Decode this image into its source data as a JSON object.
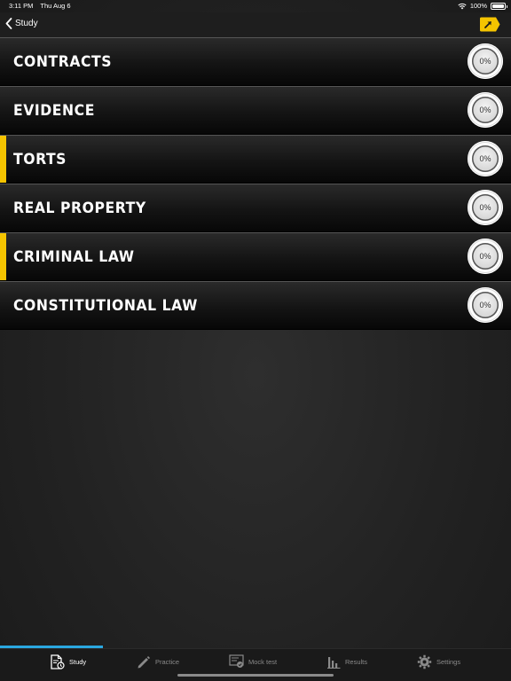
{
  "status_bar": {
    "time": "3:11 PM",
    "date": "Thu Aug 6",
    "battery": "100%",
    "wifi_icon": "wifi-icon",
    "battery_icon": "battery-icon"
  },
  "nav": {
    "back_label": "Study",
    "back_icon": "chevron-left-icon",
    "action_icon": "flag-arrow-icon",
    "accent": "#f5c400"
  },
  "subjects": [
    {
      "label": "CONTRACTS",
      "progress": "0%",
      "highlighted": false
    },
    {
      "label": "EVIDENCE",
      "progress": "0%",
      "highlighted": false
    },
    {
      "label": "TORTS",
      "progress": "0%",
      "highlighted": true
    },
    {
      "label": "REAL PROPERTY",
      "progress": "0%",
      "highlighted": false
    },
    {
      "label": "CRIMINAL LAW",
      "progress": "0%",
      "highlighted": true
    },
    {
      "label": "CONSTITUTIONAL LAW",
      "progress": "0%",
      "highlighted": false
    }
  ],
  "tabs": [
    {
      "label": "Study",
      "icon": "study-document-icon",
      "active": true
    },
    {
      "label": "Practice",
      "icon": "pencil-icon",
      "active": false
    },
    {
      "label": "Mock test",
      "icon": "mock-test-icon",
      "active": false
    },
    {
      "label": "Results",
      "icon": "bar-chart-icon",
      "active": false
    },
    {
      "label": "Settings",
      "icon": "gear-icon",
      "active": false
    }
  ],
  "colors": {
    "highlight": "#f5c400",
    "tab_indicator": "#2aa7e0"
  }
}
